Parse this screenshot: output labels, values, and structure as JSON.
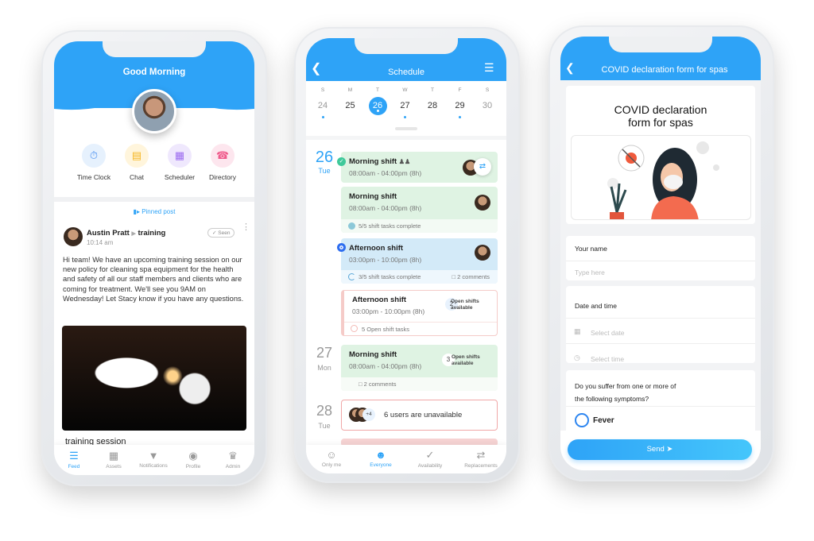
{
  "feed": {
    "header_title": "Good Morning",
    "quick_actions": [
      {
        "label": "Time Clock",
        "icon": "stopwatch-icon",
        "color": "#4a90f0",
        "bg": "#e6f1fd"
      },
      {
        "label": "Chat",
        "icon": "chat-icon",
        "color": "#f5b622",
        "bg": "#fff5dc"
      },
      {
        "label": "Scheduler",
        "icon": "calendar-icon",
        "color": "#9c6cf0",
        "bg": "#efe8fd"
      },
      {
        "label": "Directory",
        "icon": "phone-icon",
        "color": "#ef5b8c",
        "bg": "#fde6ee"
      }
    ],
    "pinned_label": "Pinned post",
    "post": {
      "author": "Austin Pratt",
      "channel": "training",
      "time": "10:14 am",
      "seen_label": "Seen",
      "body": "Hi team! We have an upcoming training session on our new policy for cleaning spa equipment for the health and safety of all our staff members and clients who are coming for treatment. We'll see you 9AM on Wednesday! Let Stacy know if you have any questions.",
      "title": "training session"
    },
    "tabs": [
      {
        "label": "Feed",
        "active": true
      },
      {
        "label": "Assets"
      },
      {
        "label": "Notifications"
      },
      {
        "label": "Profile"
      },
      {
        "label": "Admin"
      }
    ]
  },
  "schedule": {
    "title": "Schedule",
    "week": [
      {
        "d": "S",
        "n": "24",
        "dot": true
      },
      {
        "d": "M",
        "n": "25"
      },
      {
        "d": "T",
        "n": "26",
        "selected": true
      },
      {
        "d": "W",
        "n": "27",
        "dot": true
      },
      {
        "d": "T",
        "n": "28"
      },
      {
        "d": "F",
        "n": "29",
        "dot": true
      },
      {
        "d": "S",
        "n": "30"
      }
    ],
    "days": [
      {
        "num": "26",
        "wd": "Tue"
      },
      {
        "num": "27",
        "wd": "Mon"
      },
      {
        "num": "28",
        "wd": "Tue"
      }
    ],
    "shifts": [
      {
        "title": "Morning shift",
        "time": "08:00am - 04:00pm (8h)"
      },
      {
        "title": "Morning shift",
        "time": "08:00am - 04:00pm (8h)",
        "footer": "5/5 shift tasks complete"
      },
      {
        "title": "Afternoon shift",
        "time": "03:00pm - 10:00pm (8h)",
        "footer": "3/5 shift tasks complete",
        "comments": "2 comments"
      },
      {
        "title": "Afternoon shift",
        "time": "03:00pm - 10:00pm (8h)",
        "footer": "5 Open shift tasks",
        "open_count": "2",
        "open_label": "Open shifts available"
      },
      {
        "title": "Morning shift",
        "time": "08:00am - 04:00pm (8h)",
        "footer": "2 comments",
        "open_count": "3",
        "open_label": "Open shifts available"
      }
    ],
    "unavailable": {
      "extra": "+4",
      "text": "6 users are unavailable"
    },
    "tabs": [
      {
        "label": "Only me"
      },
      {
        "label": "Everyone",
        "active": true
      },
      {
        "label": "Availability"
      },
      {
        "label": "Replacements"
      }
    ],
    "colors": {
      "green": "#dff3e3",
      "blue": "#d3eaf8",
      "accent": "#2ea3f7"
    }
  },
  "form": {
    "header_title": "COVID declaration form for spas",
    "title_line1": "COVID declaration",
    "title_line2": "form for spas",
    "name_label": "Your name",
    "name_placeholder": "Type here",
    "datetime_label": "Date and time",
    "date_placeholder": "Select date",
    "time_placeholder": "Select time",
    "symptoms_line1": "Do you suffer from one or more of",
    "symptoms_line2": "the following symptoms?",
    "option_fever": "Fever",
    "send_label": "Send"
  }
}
